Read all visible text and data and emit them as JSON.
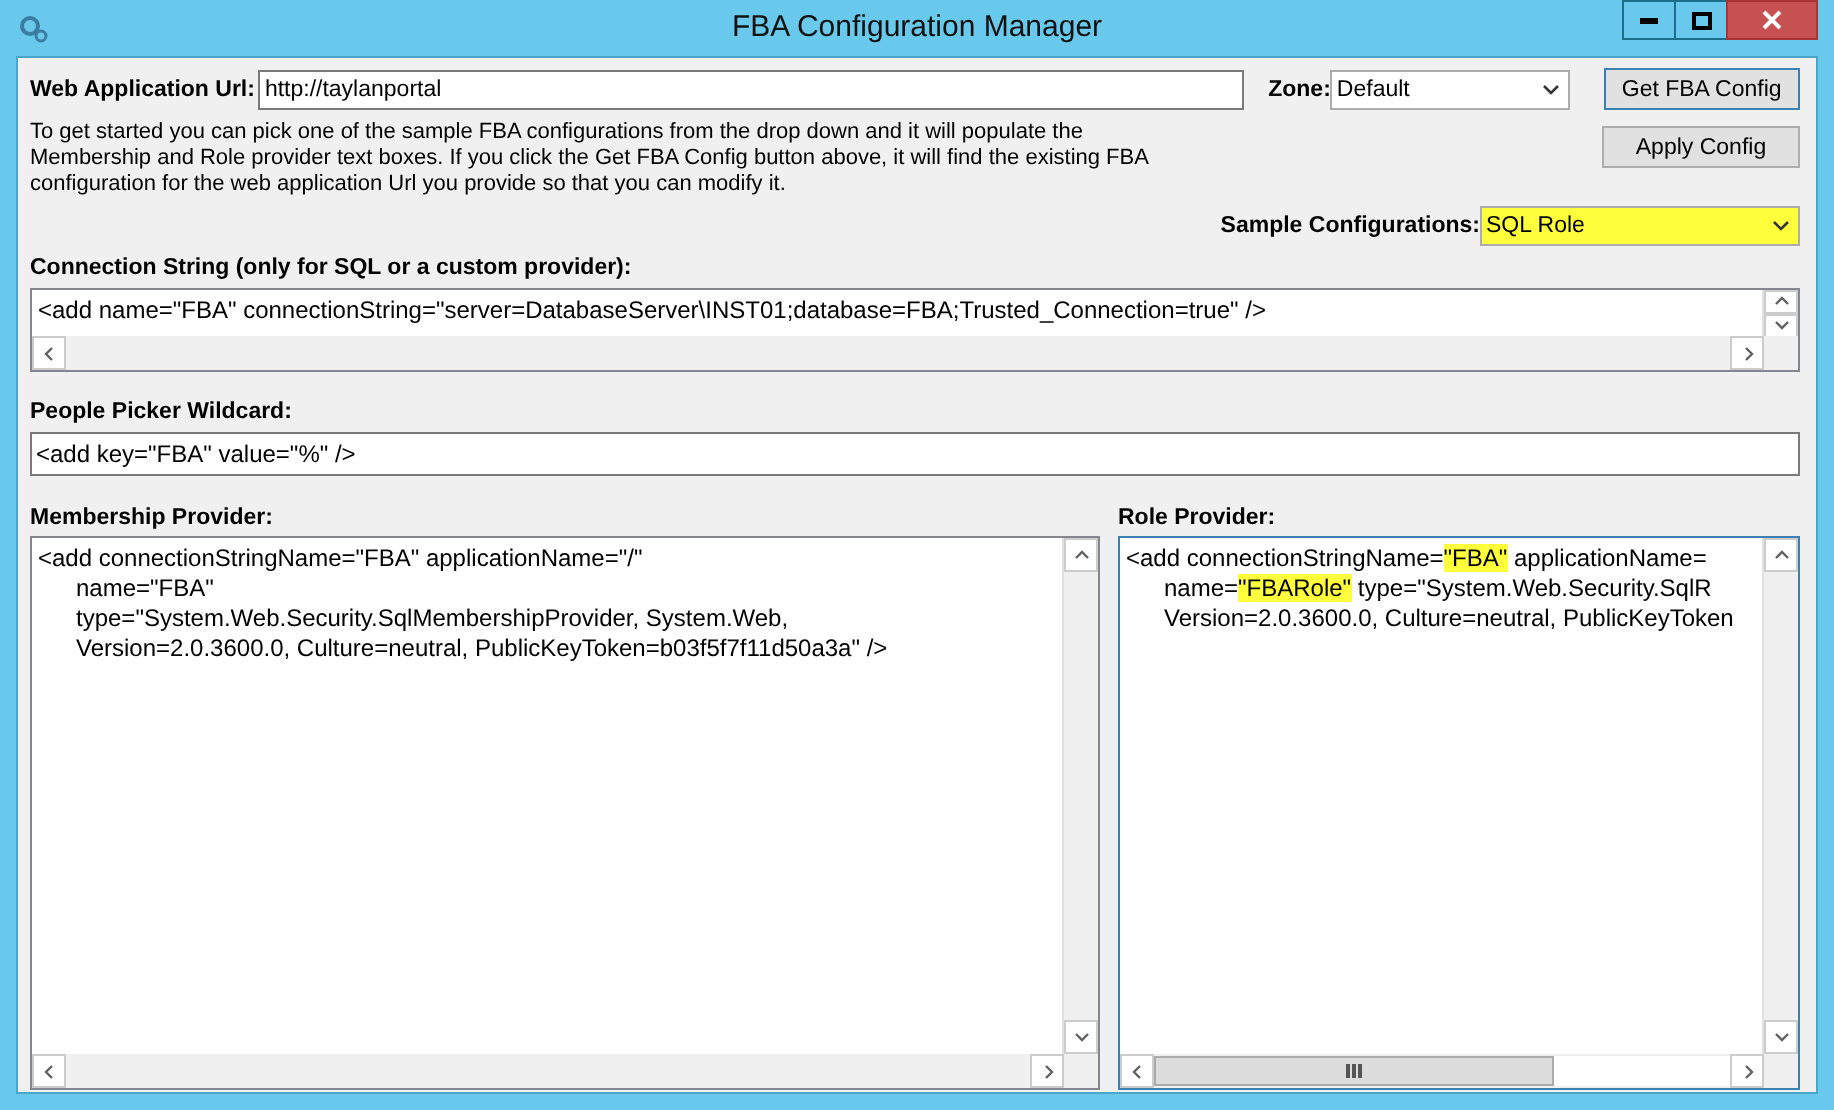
{
  "window": {
    "title": "FBA Configuration Manager"
  },
  "web_application_url": {
    "label": "Web Application Url:",
    "value": "http://taylanportal"
  },
  "zone": {
    "label": "Zone:",
    "value": "Default"
  },
  "buttons": [
    {
      "label": "Get FBA Config",
      "default": true
    },
    {
      "label": "Apply Config",
      "default": false
    }
  ],
  "instructions": "To get started you can pick one of the sample FBA configurations from the drop down and it will populate the Membership and Role provider text boxes.  If you click the Get FBA Config button above, it will find the existing FBA configuration for the web application Url you provide so that you can modify it.",
  "sample_configurations": {
    "label": "Sample Configurations:",
    "value": "SQL Role",
    "highlighted": true
  },
  "connection_string": {
    "label": "Connection String (only for SQL or a custom provider):",
    "value": "<add name=\"FBA\" connectionString=\"server=DatabaseServer\\INST01;database=FBA;Trusted_Connection=true\" />"
  },
  "people_picker_wildcard": {
    "label": "People Picker Wildcard:",
    "value": "<add key=\"FBA\" value=\"%\" />"
  },
  "membership_provider": {
    "label": "Membership Provider:",
    "lines": [
      [
        {
          "text": "<add connectionStringName=\"FBA\" applicationName=\"/\"",
          "highlighted": false
        }
      ],
      [
        {
          "text": "name=\"FBA\"",
          "highlighted": false
        }
      ],
      [
        {
          "text": "type=\"System.Web.Security.SqlMembershipProvider, System.Web,",
          "highlighted": false
        }
      ],
      [
        {
          "text": "Version=2.0.3600.0, Culture=neutral, PublicKeyToken=b03f5f7f11d50a3a\" />",
          "highlighted": false
        }
      ]
    ]
  },
  "role_provider": {
    "label": "Role Provider:",
    "lines": [
      [
        {
          "text": "<add connectionStringName=",
          "highlighted": false
        },
        {
          "text": "\"FBA\"",
          "highlighted": true
        },
        {
          "text": " applicationName=",
          "highlighted": false
        }
      ],
      [
        {
          "text": "name=",
          "highlighted": false
        },
        {
          "text": "\"FBARole\"",
          "highlighted": true
        },
        {
          "text": " type=\"System.Web.Security.SqlR",
          "highlighted": false
        }
      ],
      [
        {
          "text": "Version=2.0.3600.0, Culture=neutral, PublicKeyToken",
          "highlighted": false
        }
      ]
    ]
  }
}
